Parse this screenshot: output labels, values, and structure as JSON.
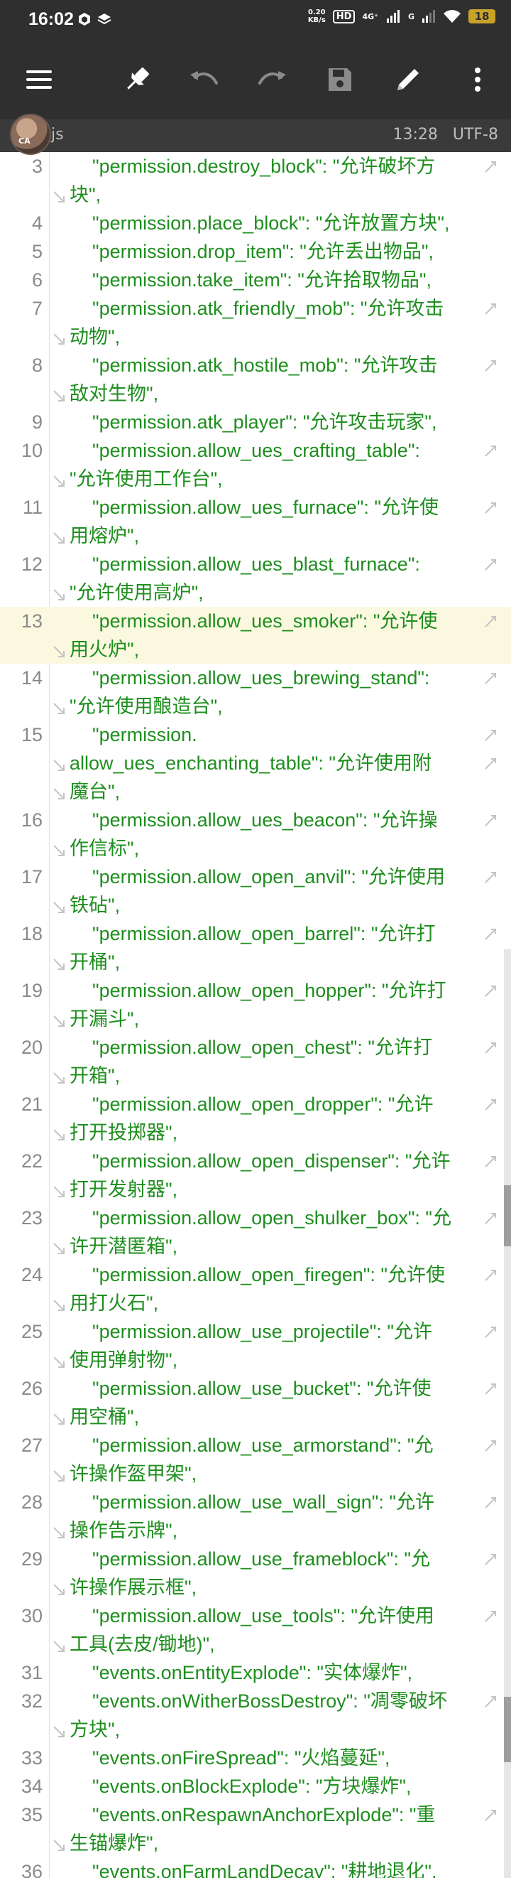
{
  "status_bar": {
    "time": "16:02",
    "net_speed_value": "0.20",
    "net_speed_unit": "KB/s",
    "hd_label": "HD",
    "signal_label": "4G⁺",
    "signal2_label": "G",
    "battery_level": "18"
  },
  "toolbar": {
    "menu_icon": "menu-icon",
    "pin_icon": "pin-icon",
    "undo_icon": "undo-icon",
    "redo_icon": "redo-icon",
    "save_icon": "save-icon",
    "edit_icon": "pencil-icon",
    "more_icon": "more-vert-icon"
  },
  "file_bar": {
    "avatar_text": "CA",
    "file_name": "js",
    "time": "13:28",
    "encoding": "UTF-8"
  },
  "code_lines": [
    {
      "num": "3",
      "segments": [
        "\"permission.destroy_block\": \"允许破坏方",
        "块\","
      ]
    },
    {
      "num": "4",
      "segments": [
        "\"permission.place_block\": \"允许放置方块\","
      ]
    },
    {
      "num": "5",
      "segments": [
        "\"permission.drop_item\": \"允许丢出物品\","
      ]
    },
    {
      "num": "6",
      "segments": [
        "\"permission.take_item\": \"允许拾取物品\","
      ]
    },
    {
      "num": "7",
      "segments": [
        "\"permission.atk_friendly_mob\": \"允许攻击",
        "动物\","
      ]
    },
    {
      "num": "8",
      "segments": [
        "\"permission.atk_hostile_mob\": \"允许攻击",
        "敌对生物\","
      ]
    },
    {
      "num": "9",
      "segments": [
        "\"permission.atk_player\": \"允许攻击玩家\","
      ]
    },
    {
      "num": "10",
      "segments": [
        "\"permission.allow_ues_crafting_table\":",
        "\"允许使用工作台\","
      ]
    },
    {
      "num": "11",
      "segments": [
        "\"permission.allow_ues_furnace\": \"允许使",
        "用熔炉\","
      ]
    },
    {
      "num": "12",
      "segments": [
        "\"permission.allow_ues_blast_furnace\":",
        "\"允许使用高炉\","
      ]
    },
    {
      "num": "13",
      "segments": [
        "\"permission.allow_ues_smoker\": \"允许使",
        "用火炉\","
      ],
      "highlight": true
    },
    {
      "num": "14",
      "segments": [
        "\"permission.allow_ues_brewing_stand\":",
        "\"允许使用酿造台\","
      ]
    },
    {
      "num": "15",
      "segments": [
        "\"permission.",
        "allow_ues_enchanting_table\": \"允许使用附",
        "魔台\","
      ]
    },
    {
      "num": "16",
      "segments": [
        "\"permission.allow_ues_beacon\": \"允许操",
        "作信标\","
      ]
    },
    {
      "num": "17",
      "segments": [
        "\"permission.allow_open_anvil\": \"允许使用",
        "铁砧\","
      ]
    },
    {
      "num": "18",
      "segments": [
        "\"permission.allow_open_barrel\": \"允许打",
        "开桶\","
      ]
    },
    {
      "num": "19",
      "segments": [
        "\"permission.allow_open_hopper\": \"允许打",
        "开漏斗\","
      ]
    },
    {
      "num": "20",
      "segments": [
        "\"permission.allow_open_chest\": \"允许打",
        "开箱\","
      ]
    },
    {
      "num": "21",
      "segments": [
        "\"permission.allow_open_dropper\": \"允许",
        "打开投掷器\","
      ]
    },
    {
      "num": "22",
      "segments": [
        "\"permission.allow_open_dispenser\": \"允许",
        "打开发射器\","
      ]
    },
    {
      "num": "23",
      "segments": [
        "\"permission.allow_open_shulker_box\": \"允",
        "许开潜匿箱\","
      ]
    },
    {
      "num": "24",
      "segments": [
        "\"permission.allow_open_firegen\": \"允许使",
        "用打火石\","
      ]
    },
    {
      "num": "25",
      "segments": [
        "\"permission.allow_use_projectile\": \"允许",
        "使用弹射物\","
      ]
    },
    {
      "num": "26",
      "segments": [
        "\"permission.allow_use_bucket\": \"允许使",
        "用空桶\","
      ]
    },
    {
      "num": "27",
      "segments": [
        "\"permission.allow_use_armorstand\": \"允",
        "许操作盔甲架\","
      ]
    },
    {
      "num": "28",
      "segments": [
        "\"permission.allow_use_wall_sign\": \"允许",
        "操作告示牌\","
      ]
    },
    {
      "num": "29",
      "segments": [
        "\"permission.allow_use_frameblock\": \"允",
        "许操作展示框\","
      ]
    },
    {
      "num": "30",
      "segments": [
        "\"permission.allow_use_tools\": \"允许使用",
        "工具(去皮/锄地)\","
      ]
    },
    {
      "num": "31",
      "segments": [
        "\"events.onEntityExplode\": \"实体爆炸\","
      ]
    },
    {
      "num": "32",
      "segments": [
        "\"events.onWitherBossDestroy\": \"凋零破坏",
        "方块\","
      ]
    },
    {
      "num": "33",
      "segments": [
        "\"events.onFireSpread\": \"火焰蔓延\","
      ]
    },
    {
      "num": "34",
      "segments": [
        "\"events.onBlockExplode\": \"方块爆炸\","
      ]
    },
    {
      "num": "35",
      "segments": [
        "\"events.onRespawnAnchorExplode\": \"重",
        "生锚爆炸\","
      ]
    },
    {
      "num": "36",
      "segments": [
        "\"events.onFarmLandDecay\": \"耕地退化\","
      ]
    }
  ],
  "colors": {
    "toolbar_bg": "#2f2f2f",
    "file_bar_bg": "#3a3a3a",
    "string_green": "#1e8e1e",
    "line_number_gray": "#8a8a8a",
    "current_line_highlight": "#fbf8e0"
  }
}
